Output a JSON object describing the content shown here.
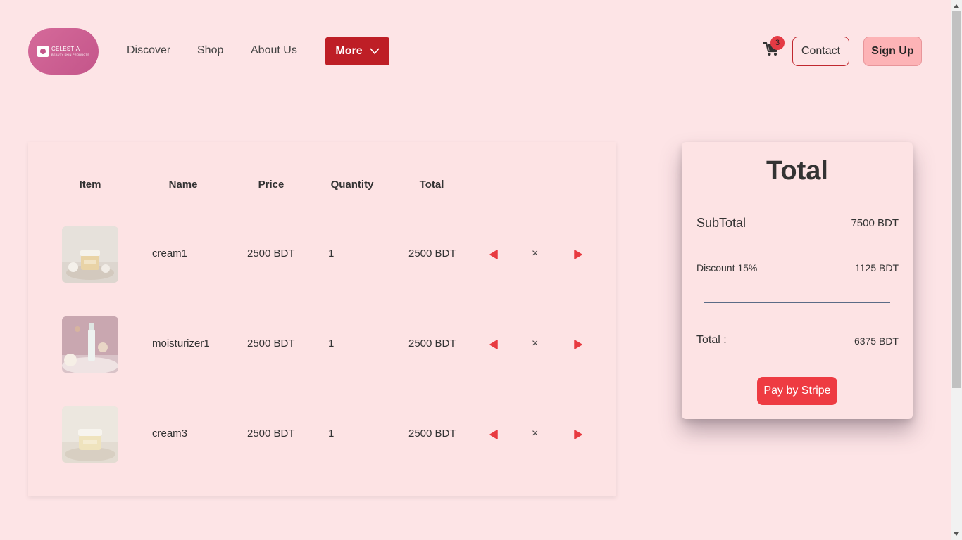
{
  "brand": {
    "line1": "CELESTIA",
    "line2": "BEAUTY SKIN PRODUCTS"
  },
  "nav": {
    "discover": "Discover",
    "shop": "Shop",
    "about": "About Us",
    "more": "More"
  },
  "header_actions": {
    "cart_count": "3",
    "contact": "Contact",
    "signup": "Sign Up"
  },
  "table": {
    "headers": {
      "item": "Item",
      "name": "Name",
      "price": "Price",
      "quantity": "Quantity",
      "total": "Total"
    },
    "rows": [
      {
        "name": "cream1",
        "price": "2500 BDT",
        "quantity": "1",
        "total": "2500 BDT",
        "remove": "×"
      },
      {
        "name": "moisturizer1",
        "price": "2500 BDT",
        "quantity": "1",
        "total": "2500 BDT",
        "remove": "×"
      },
      {
        "name": "cream3",
        "price": "2500 BDT",
        "quantity": "1",
        "total": "2500 BDT",
        "remove": "×"
      }
    ]
  },
  "summary": {
    "title": "Total",
    "subtotal_label": "SubTotal",
    "subtotal_value": "7500 BDT",
    "discount_label": "Discount 15%",
    "discount_value": "1125 BDT",
    "total_label": "Total :",
    "total_value": "6375 BDT",
    "pay_button": "Pay by Stripe"
  },
  "colors": {
    "background": "#fde4e6",
    "accent_red": "#be1e26",
    "button_red": "#ee3b42",
    "arrow_red": "#e83a40"
  },
  "icons": [
    "cart-icon",
    "chevron-down-icon",
    "decrement-arrow-icon",
    "increment-arrow-icon",
    "close-icon"
  ]
}
